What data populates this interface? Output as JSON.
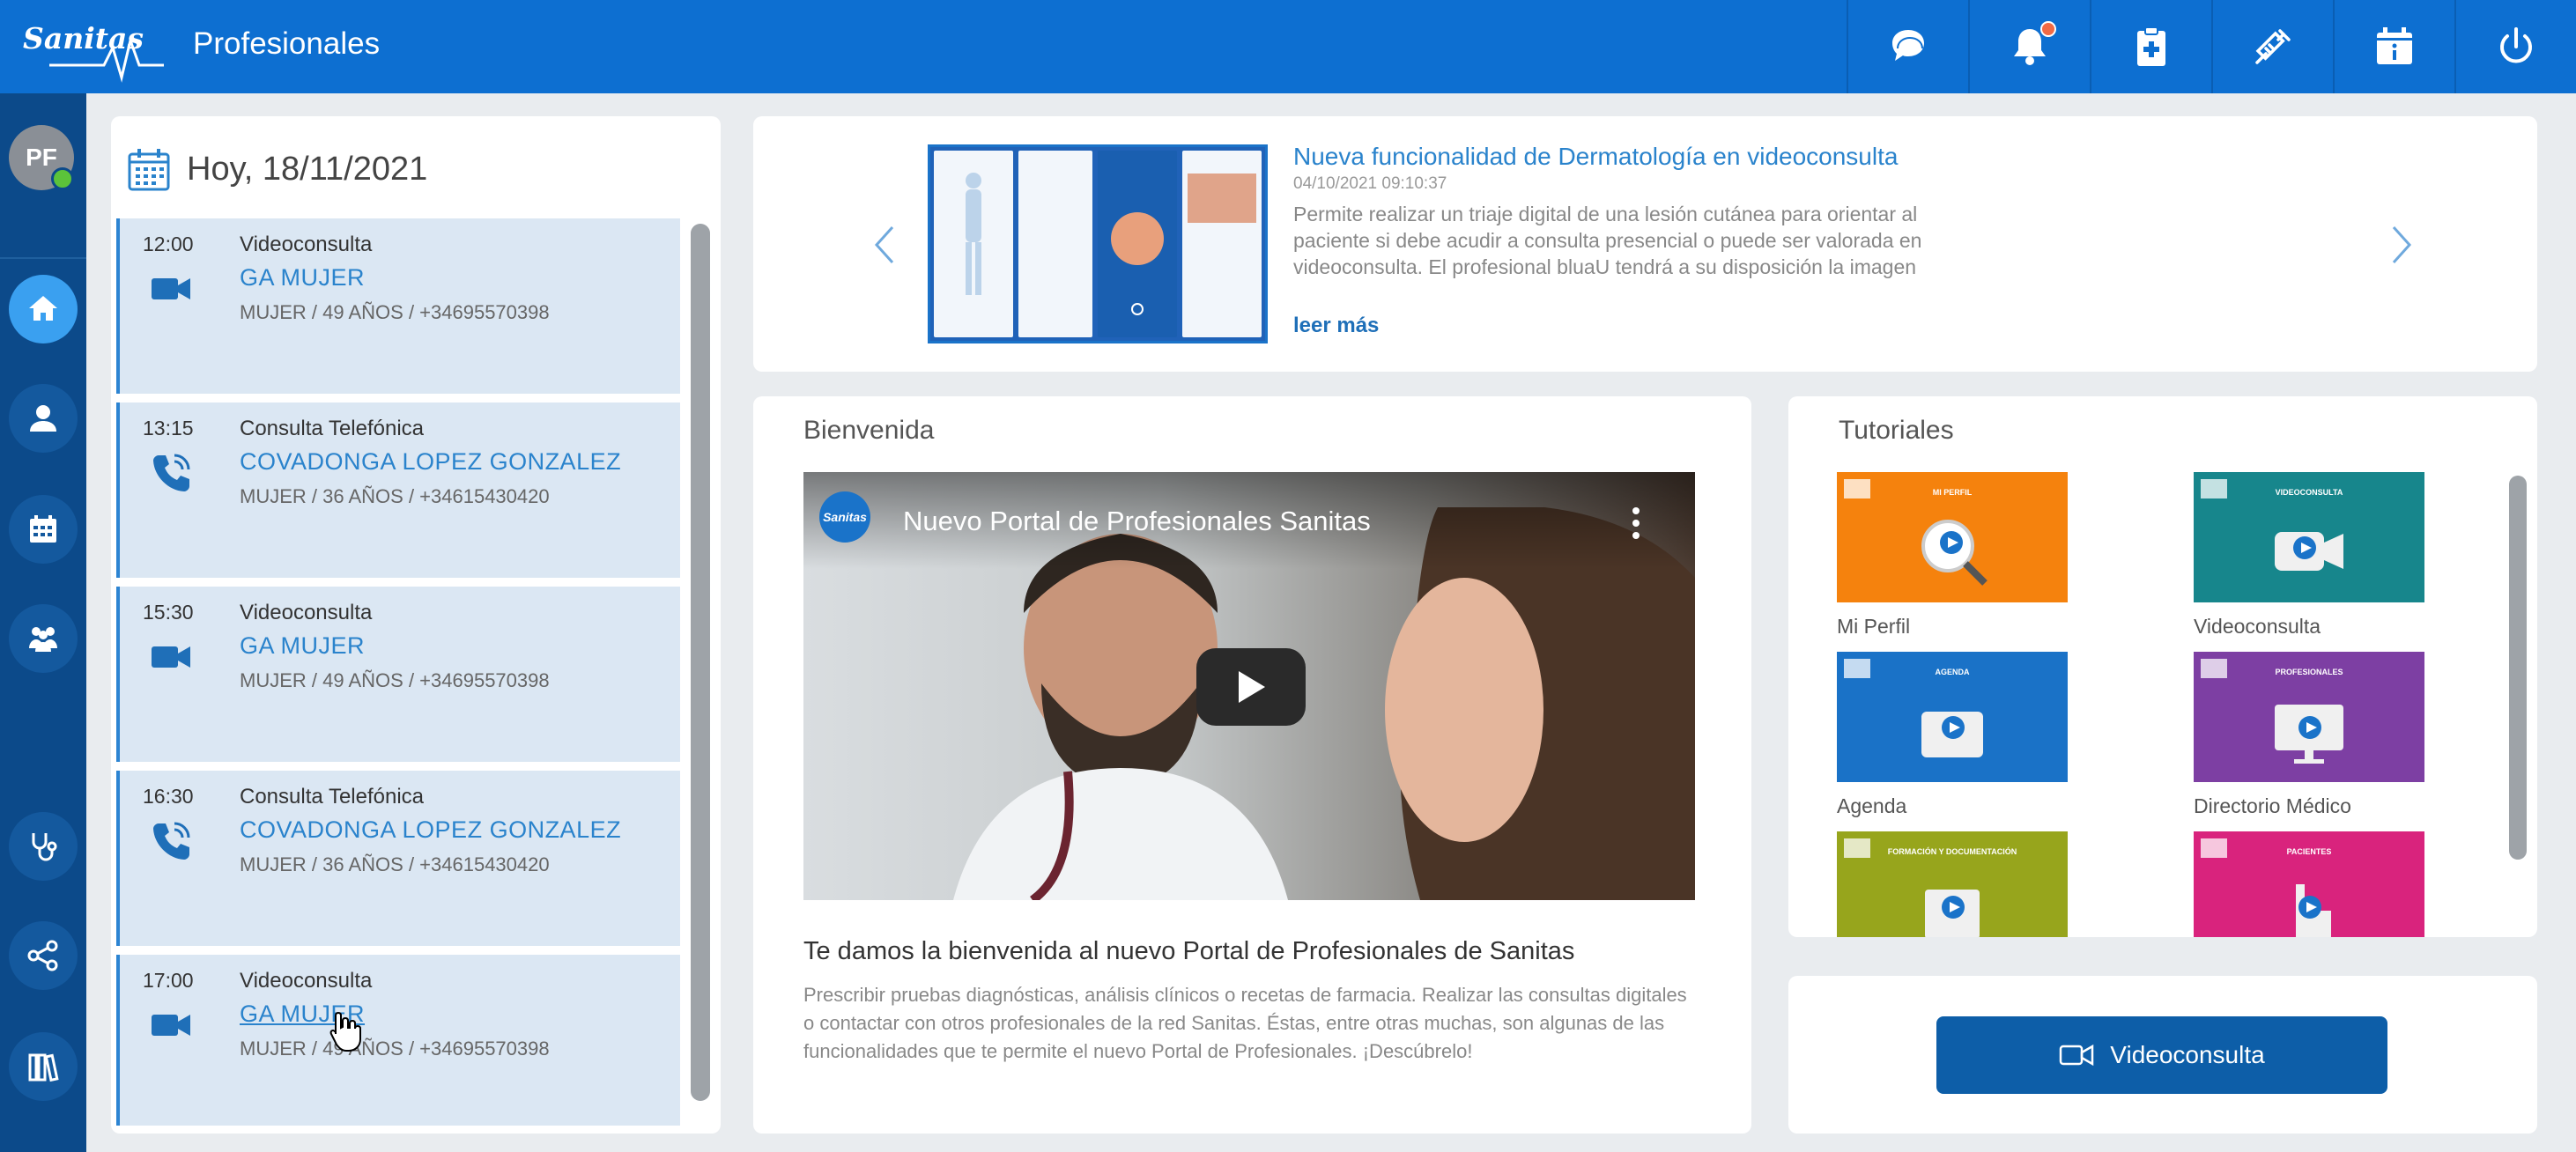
{
  "header": {
    "logo": "Sanitas",
    "title": "Profesionales",
    "actions": [
      {
        "icon": "chat-icon"
      },
      {
        "icon": "bell-icon",
        "has_notification": true
      },
      {
        "icon": "clipboard-plus-icon"
      },
      {
        "icon": "syringe-icon"
      },
      {
        "icon": "calendar-info-icon"
      },
      {
        "icon": "power-icon"
      }
    ]
  },
  "sidebar": {
    "avatar_initials": "PF",
    "status_color": "#5cc33a",
    "items": [
      {
        "icon": "home-icon",
        "active": true
      },
      {
        "icon": "user-icon"
      },
      {
        "icon": "calendar-icon"
      },
      {
        "icon": "group-icon"
      },
      {
        "icon": "stethoscope-icon"
      },
      {
        "icon": "share-network-icon"
      },
      {
        "icon": "library-icon"
      }
    ]
  },
  "agenda": {
    "title": "Hoy, 18/11/2021",
    "appointments": [
      {
        "time": "12:00",
        "type": "Videoconsulta",
        "icon": "video-camera-icon",
        "name": "GA MUJER",
        "info": "MUJER / 49 AÑOS / +34695570398"
      },
      {
        "time": "13:15",
        "type": "Consulta Telefónica",
        "icon": "phone-icon",
        "name": "COVADONGA LOPEZ GONZALEZ",
        "info": "MUJER / 36 AÑOS / +34615430420"
      },
      {
        "time": "15:30",
        "type": "Videoconsulta",
        "icon": "video-camera-icon",
        "name": "GA MUJER",
        "info": "MUJER / 49 AÑOS / +34695570398"
      },
      {
        "time": "16:30",
        "type": "Consulta Telefónica",
        "icon": "phone-icon",
        "name": "COVADONGA LOPEZ GONZALEZ",
        "info": "MUJER / 36 AÑOS / +34615430420"
      },
      {
        "time": "17:00",
        "type": "Videoconsulta",
        "icon": "video-camera-icon",
        "name": "GA MUJER",
        "info": "MUJER / 49 AÑOS / +34695570398"
      }
    ]
  },
  "news": {
    "title": "Nueva funcionalidad de Dermatología en videoconsulta",
    "date": "04/10/2021 09:10:37",
    "text": "Permite realizar un triaje digital de una lesión cutánea para orientar al paciente si debe acudir a consulta presencial o puede ser valorada en videoconsulta. El profesional bluaU tendrá a su disposición la imagen escaneada en el chat de la plataforma.",
    "more": "leer más"
  },
  "welcome": {
    "section_title": "Bienvenida",
    "video_title": "Nuevo Portal de Profesionales Sanitas",
    "video_channel": "Sanitas",
    "heading": "Te damos la bienvenida al nuevo Portal de Profesionales de Sanitas",
    "text": "Prescribir pruebas diagnósticas, análisis clínicos o recetas de farmacia. Realizar las consultas digitales o contactar con otros profesionales de la red Sanitas. Éstas, entre otras muchas, son algunas de las funcionalidades que te permite el nuevo Portal de Profesionales. ¡Descúbrelo!"
  },
  "tutorials": {
    "section_title": "Tutoriales",
    "items": [
      {
        "label": "Mi Perfil",
        "caption": "MI PERFIL",
        "color": "#f5820d"
      },
      {
        "label": "Videoconsulta",
        "caption": "VIDEOCONSULTA",
        "color": "#17868c"
      },
      {
        "label": "Agenda",
        "caption": "AGENDA",
        "color": "#1a72c7"
      },
      {
        "label": "Directorio Médico",
        "caption": "PROFESIONALES",
        "color": "#7d3fa3"
      },
      {
        "label": "",
        "caption": "FORMACIÓN Y DOCUMENTACIÓN",
        "color": "#97a51c"
      },
      {
        "label": "",
        "caption": "PACIENTES",
        "color": "#d9237d"
      }
    ]
  },
  "videoconsulta_button": {
    "label": "Videoconsulta"
  },
  "colors": {
    "primary": "#0d6fd1",
    "sidebar": "#0c4a8a",
    "link": "#2a83cc",
    "notification": "#f26a45"
  }
}
